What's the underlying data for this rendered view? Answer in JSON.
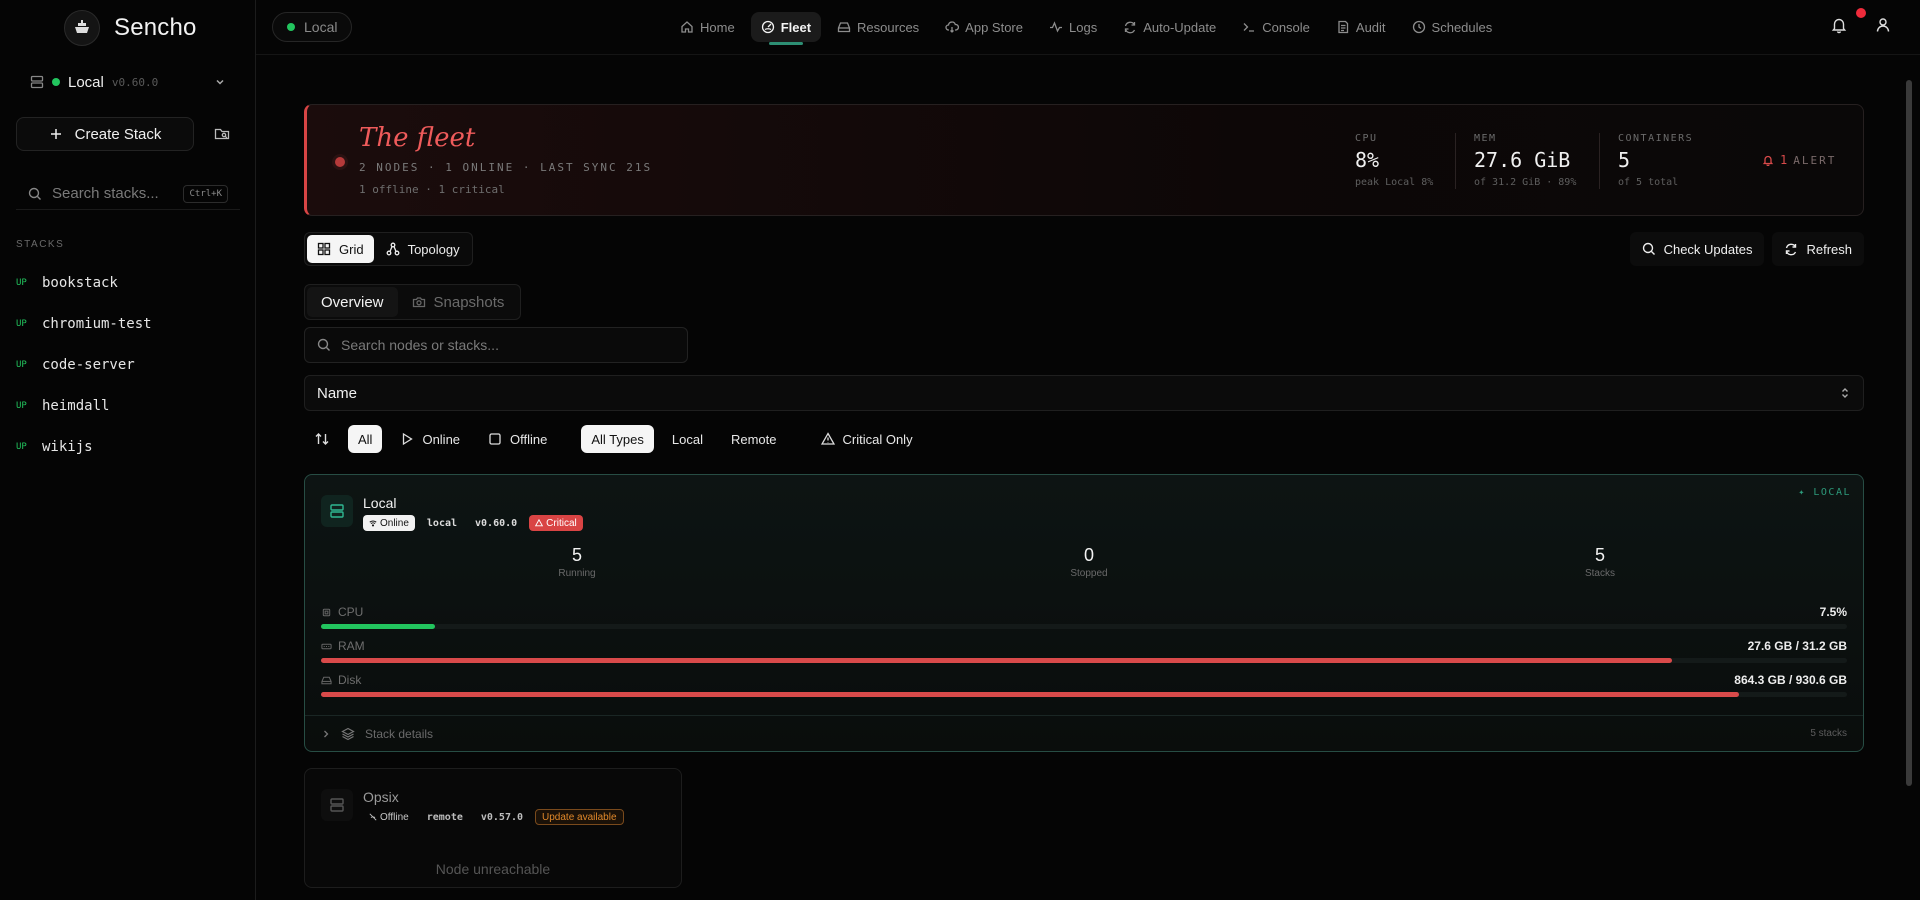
{
  "app": {
    "name": "Sencho"
  },
  "sidebar": {
    "node_name": "Local",
    "node_version": "v0.60.0",
    "create_label": "Create Stack",
    "search_placeholder": "Search stacks...",
    "search_shortcut": "Ctrl+K",
    "stacks_heading": "STACKS",
    "stacks": [
      {
        "status": "UP",
        "name": "bookstack"
      },
      {
        "status": "UP",
        "name": "chromium-test"
      },
      {
        "status": "UP",
        "name": "code-server"
      },
      {
        "status": "UP",
        "name": "heimdall"
      },
      {
        "status": "UP",
        "name": "wikijs"
      }
    ]
  },
  "topbar": {
    "env_label": "Local",
    "nav": [
      {
        "label": "Home",
        "icon": "home-icon"
      },
      {
        "label": "Fleet",
        "icon": "fleet-icon",
        "active": true
      },
      {
        "label": "Resources",
        "icon": "resources-icon"
      },
      {
        "label": "App Store",
        "icon": "cloud-download-icon"
      },
      {
        "label": "Logs",
        "icon": "activity-icon"
      },
      {
        "label": "Auto-Update",
        "icon": "refresh-icon"
      },
      {
        "label": "Console",
        "icon": "terminal-icon"
      },
      {
        "label": "Audit",
        "icon": "audit-icon"
      },
      {
        "label": "Schedules",
        "icon": "clock-icon"
      }
    ]
  },
  "hero": {
    "title": "The fleet",
    "subtitle": "2 NODES · 1 ONLINE · LAST SYNC 21S",
    "sub2": "1 offline · 1 critical",
    "cpu": {
      "label": "CPU",
      "value": "8%",
      "sub": "peak Local 8%"
    },
    "mem": {
      "label": "MEM",
      "value": "27.6 GiB",
      "sub": "of 31.2 GiB · 89%"
    },
    "containers": {
      "label": "CONTAINERS",
      "value": "5",
      "sub": "of 5 total"
    },
    "alert_count": "1",
    "alert_word": "ALERT"
  },
  "view_toggle": {
    "grid": "Grid",
    "topology": "Topology"
  },
  "actions": {
    "check_updates": "Check Updates",
    "refresh": "Refresh"
  },
  "tabs": {
    "overview": "Overview",
    "snapshots": "Snapshots"
  },
  "search_nodes_placeholder": "Search nodes or stacks...",
  "sort_value": "Name",
  "filters": {
    "all": "All",
    "online": "Online",
    "offline": "Offline",
    "all_types": "All Types",
    "local": "Local",
    "remote": "Remote",
    "critical": "Critical Only"
  },
  "node_local": {
    "name": "Local",
    "tag": "LOCAL",
    "badges": {
      "status": "Online",
      "type": "local",
      "version": "v0.60.0",
      "health": "Critical"
    },
    "running": {
      "n": "5",
      "label": "Running"
    },
    "stopped": {
      "n": "0",
      "label": "Stopped"
    },
    "stacks": {
      "n": "5",
      "label": "Stacks"
    },
    "cpu": {
      "label": "CPU",
      "value": "7.5%",
      "fraction": 0.075
    },
    "ram": {
      "label": "RAM",
      "value": "27.6 GB / 31.2 GB",
      "fraction": 0.885
    },
    "disk": {
      "label": "Disk",
      "value": "864.3 GB / 930.6 GB",
      "fraction": 0.929
    },
    "foot_label": "Stack details",
    "foot_count": "5 stacks",
    "colors": {
      "ok": "#22c55e",
      "critical": "#d94a4a"
    }
  },
  "node_opsix": {
    "name": "Opsix",
    "badges": {
      "status": "Offline",
      "type": "remote",
      "version": "v0.57.0",
      "update": "Update available"
    },
    "message": "Node unreachable"
  }
}
